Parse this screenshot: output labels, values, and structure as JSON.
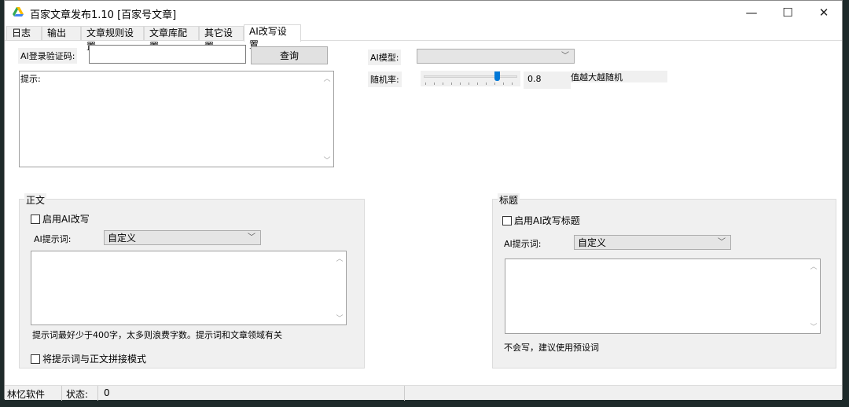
{
  "window": {
    "title": "百家文章发布1.10    [百家号文章]",
    "minimize": "—",
    "maximize": "☐",
    "close": "✕"
  },
  "tabs": [
    {
      "label": "日志"
    },
    {
      "label": "输出"
    },
    {
      "label": "文章规则设置"
    },
    {
      "label": "文章库配置"
    },
    {
      "label": "其它设置"
    },
    {
      "label": "AI改写设置",
      "active": true
    }
  ],
  "ai": {
    "code_label": "AI登录验证码:",
    "code_value": "",
    "query_button": "查询",
    "hint_label": "提示:",
    "model_label": "AI模型:",
    "model_value": "",
    "rate_label": "随机率:",
    "rate_value": "0.8",
    "rate_note": "值越大越随机",
    "rate_slider_fraction": 0.8
  },
  "body_group": {
    "title": "正文",
    "enable_label": "启用AI改写",
    "enable_checked": false,
    "prompt_label": "AI提示词:",
    "prompt_value": "自定义",
    "textarea": "",
    "note": "提示词最好少于400字，太多则浪费字数。提示词和文章领域有关",
    "concat_label": "将提示词与正文拼接模式",
    "concat_checked": false
  },
  "title_group": {
    "title": "标题",
    "enable_label": "启用AI改写标题",
    "enable_checked": false,
    "prompt_label": "AI提示词:",
    "prompt_value": "自定义",
    "textarea": "",
    "note": "不会写，建议使用预设词"
  },
  "status": {
    "brand": "林忆软件",
    "state_label": "状态:",
    "state_value": "0"
  }
}
